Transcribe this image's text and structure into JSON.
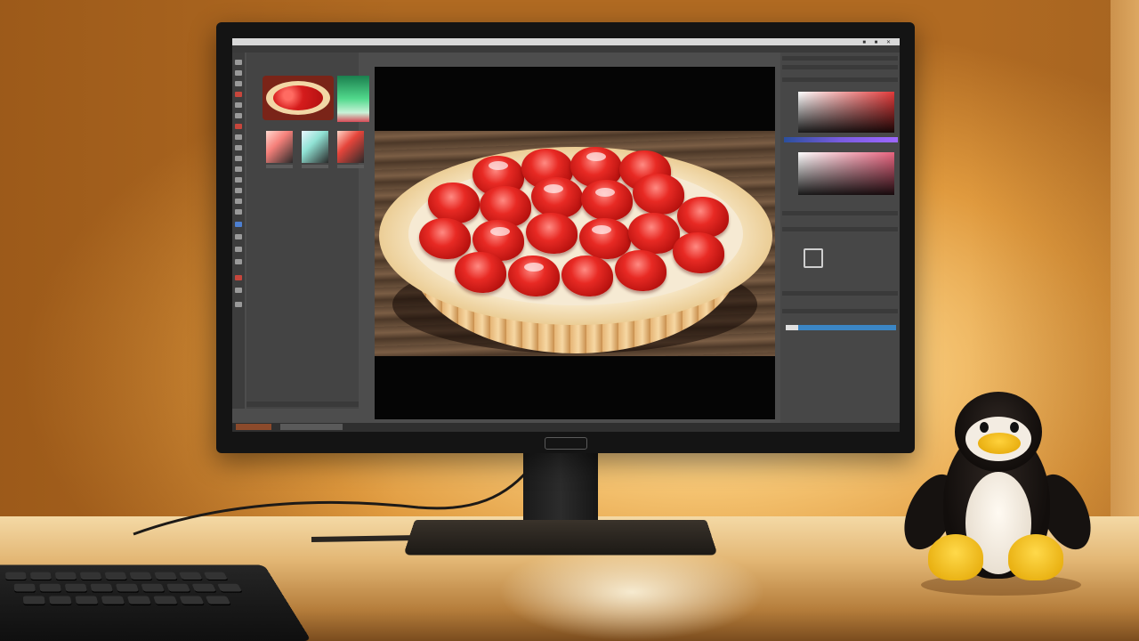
{
  "scene": {
    "description_icon": "photo-scene",
    "monitor_logo": "",
    "status_readout": "",
    "panel_readout": ""
  },
  "colors": {
    "wall_glow": "#f7c877",
    "app_panel": "#4d4d4d",
    "layer_highlight": "#3b86c5",
    "penguin_beak": "#ffd23c"
  }
}
